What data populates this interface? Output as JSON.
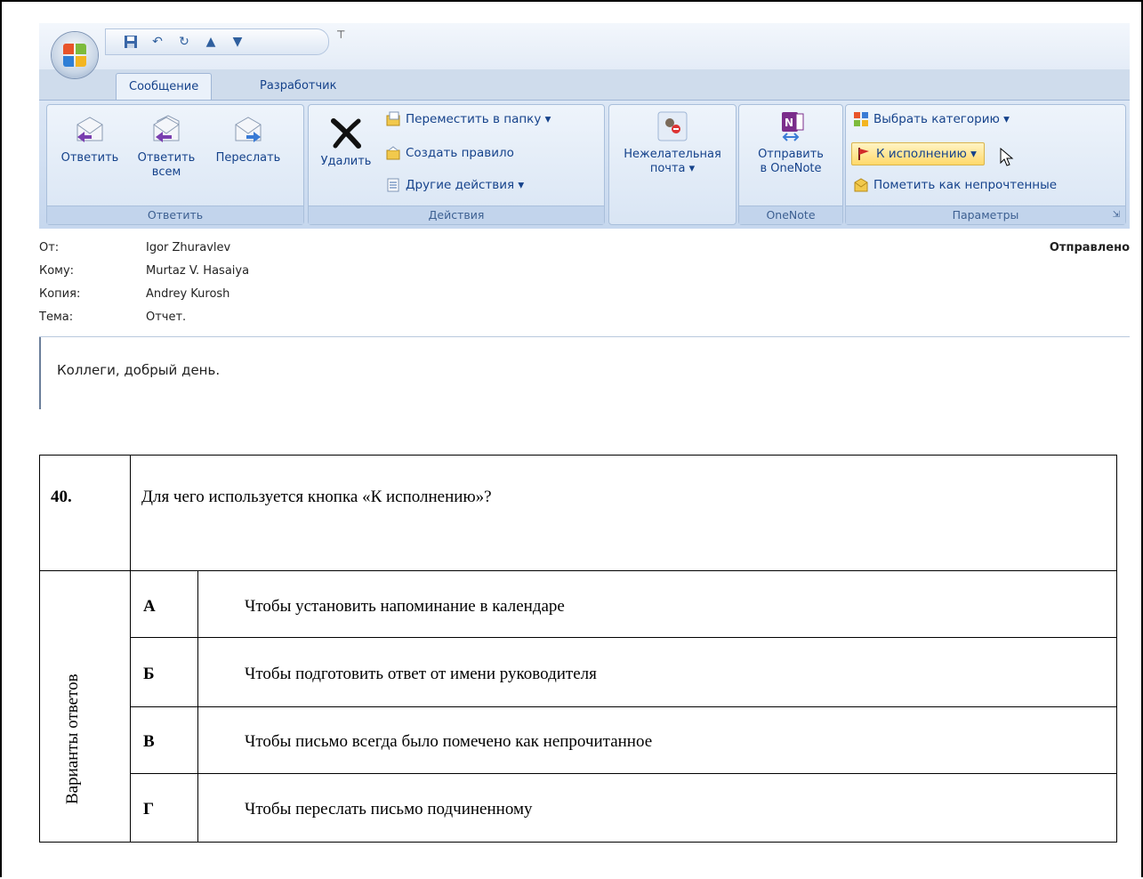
{
  "outlook": {
    "tabs": [
      {
        "label": "Сообщение"
      },
      {
        "label": "Разработчик"
      }
    ],
    "ribbon": {
      "reply_group": {
        "label": "Ответить",
        "reply": "Ответить",
        "reply_all_line1": "Ответить",
        "reply_all_line2": "всем",
        "forward": "Переслать"
      },
      "actions_group": {
        "label": "Действия",
        "delete": "Удалить",
        "move_to_folder": "Переместить в папку ▾",
        "create_rule": "Создать правило",
        "other_actions": "Другие действия ▾"
      },
      "junk_group": {
        "line1": "Нежелательная",
        "line2": "почта ▾"
      },
      "onenote_group": {
        "label": "OneNote",
        "send_line1": "Отправить",
        "send_line2": "в OneNote"
      },
      "options_group": {
        "label": "Параметры",
        "categorize": "Выбрать категорию ▾",
        "follow_up": "К исполнению ▾",
        "mark_unread": "Пометить как непрочтенные"
      }
    },
    "headers": {
      "from_label": "От:",
      "from_value": "Igor Zhuravlev",
      "to_label": "Кому:",
      "to_value": "Murtaz V. Hasaiya",
      "cc_label": "Копия:",
      "cc_value": "Andrey Kurosh",
      "subject_label": "Тема:",
      "subject_value": "Отчет.",
      "sent_label": "Отправлено"
    },
    "body_text": "Коллеги, добрый день.",
    "colors": {
      "ribbon_text": "#15428b",
      "highlight": "#ffd96b"
    }
  },
  "quiz": {
    "number": "40.",
    "question": "Для чего используется кнопка «К исполнению»?",
    "answers_label": "Варианты ответов",
    "options": [
      {
        "letter": "А",
        "text": "Чтобы установить напоминание в календаре"
      },
      {
        "letter": "Б",
        "text": "Чтобы подготовить ответ от имени руководителя"
      },
      {
        "letter": "В",
        "text": "Чтобы письмо всегда было помечено как непрочитанное"
      },
      {
        "letter": "Г",
        "text": "Чтобы переслать письмо подчиненному"
      }
    ]
  }
}
